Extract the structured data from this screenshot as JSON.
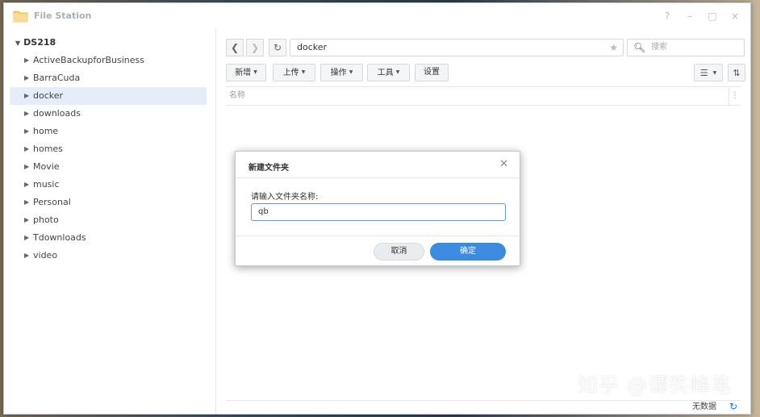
{
  "window": {
    "title": "File Station",
    "controls": {
      "help": "?",
      "minimize": "–",
      "maximize": "□",
      "close": "×"
    }
  },
  "sidebar": {
    "root": "DS218",
    "items": [
      {
        "label": "ActiveBackupforBusiness"
      },
      {
        "label": "BarraCuda"
      },
      {
        "label": "docker",
        "selected": true
      },
      {
        "label": "downloads"
      },
      {
        "label": "home"
      },
      {
        "label": "homes"
      },
      {
        "label": "Movie"
      },
      {
        "label": "music"
      },
      {
        "label": "Personal"
      },
      {
        "label": "photo"
      },
      {
        "label": "Tdownloads"
      },
      {
        "label": "video"
      }
    ]
  },
  "toolbar": {
    "path": "docker",
    "search_placeholder": "搜索",
    "buttons": {
      "new": "新增",
      "upload": "上传",
      "action": "操作",
      "tools": "工具",
      "settings": "设置"
    }
  },
  "file_list": {
    "column_name": "名称"
  },
  "status": {
    "text": "无数据"
  },
  "watermark": "知乎 @谭笑峰笔",
  "dialog": {
    "title": "新建文件夹",
    "label": "请输入文件夹名称:",
    "input_value": "qb",
    "cancel_label": "取消",
    "ok_label": "确定"
  },
  "colors": {
    "accent": "#3d8be0",
    "selected_bg": "#e4edf9"
  }
}
